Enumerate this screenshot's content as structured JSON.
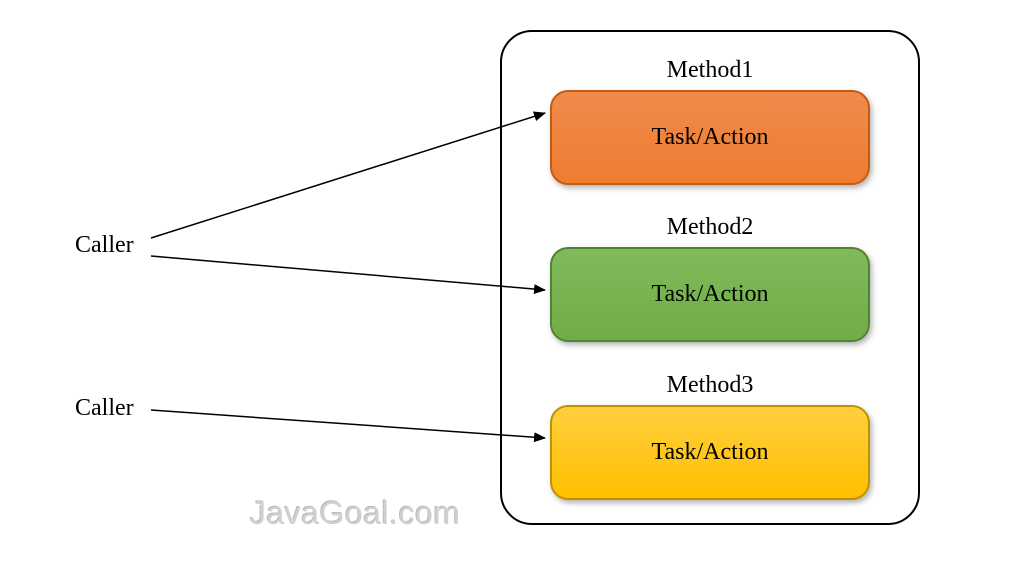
{
  "callers": [
    {
      "label": "Caller"
    },
    {
      "label": "Caller"
    }
  ],
  "methods": [
    {
      "label": "Method1",
      "task": "Task/Action",
      "color": "orange"
    },
    {
      "label": "Method2",
      "task": "Task/Action",
      "color": "green"
    },
    {
      "label": "Method3",
      "task": "Task/Action",
      "color": "yellow"
    }
  ],
  "watermark": "JavaGoal.com"
}
